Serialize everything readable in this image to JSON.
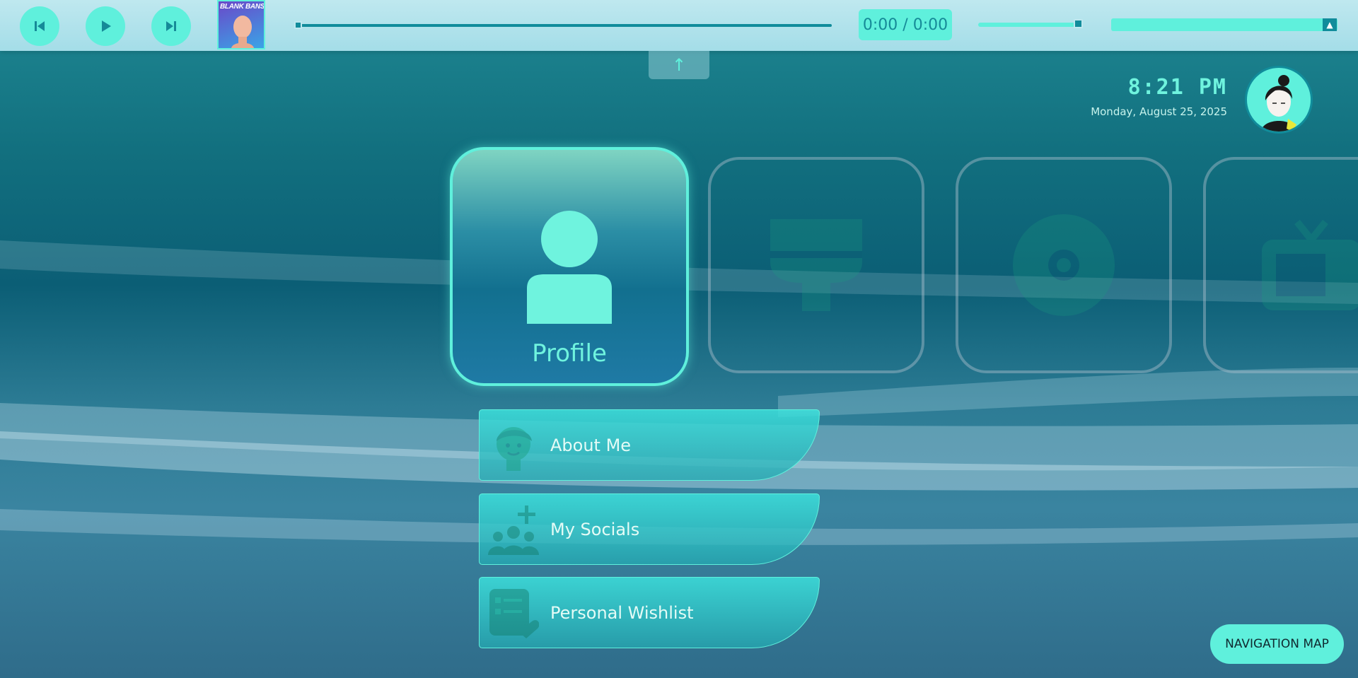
{
  "player": {
    "album_text": "BLANK BANSHEE",
    "time_display": "0:00 / 0:00",
    "progress": 0,
    "volume": 0.9
  },
  "clock": {
    "time": "8:21 PM",
    "date": "Monday, August 25, 2025"
  },
  "tiles": {
    "active_label": "Profile",
    "others": [
      "brush-icon",
      "disc-icon",
      "tv-icon"
    ]
  },
  "submenu": [
    {
      "label": "About Me",
      "icon": "face-icon"
    },
    {
      "label": "My Socials",
      "icon": "group-add-icon"
    },
    {
      "label": "Personal Wishlist",
      "icon": "wishlist-icon"
    }
  ],
  "navigation_map": "NAVIGATION MAP",
  "colors": {
    "accent": "#5ff0dc",
    "accent_dark": "#118c9b",
    "text_light": "#6ff3de"
  }
}
